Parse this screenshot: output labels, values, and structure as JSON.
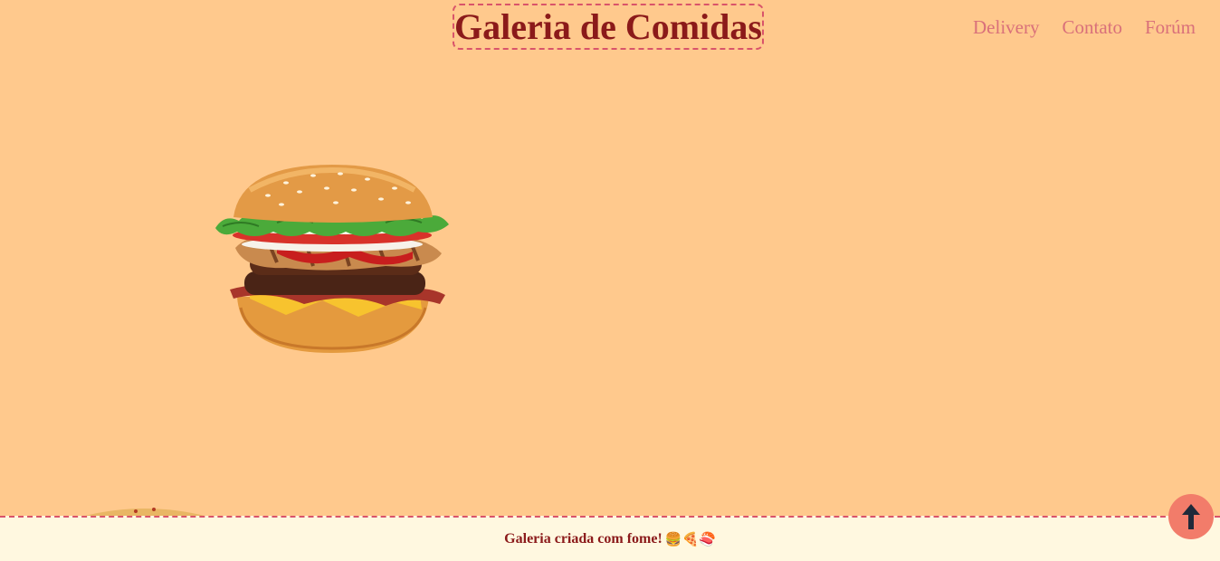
{
  "header": {
    "title": "Galeria de Comidas",
    "nav": [
      {
        "label": "Delivery"
      },
      {
        "label": "Contato"
      },
      {
        "label": "Forúm"
      }
    ]
  },
  "gallery": {
    "items": [
      {
        "icon": "burger-image"
      },
      {
        "icon": "pizza-image"
      }
    ]
  },
  "footer": {
    "text": "Galeria criada com fome!",
    "emojis": "🍔🍕🍣"
  },
  "back_to_top": {
    "icon": "arrow-up-icon"
  },
  "colors": {
    "background": "#FFC98D",
    "title": "#8B1A1A",
    "nav_link": "#D9707A",
    "footer_bg": "#FFF8E0",
    "accent": "#F27C6A",
    "dashed_border": "#D9546A"
  }
}
